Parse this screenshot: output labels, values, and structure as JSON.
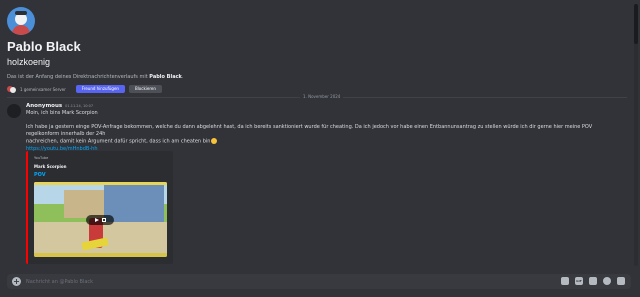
{
  "profile": {
    "display_name": "Pablo Black",
    "username": "holzkoenig",
    "intro_prefix": "Das ist der Anfang deines Direktnachrichtenverlaufs mit ",
    "intro_name": "Pablo Black",
    "intro_suffix": ".",
    "mutual_servers": "1 gemeinsamer Server",
    "add_friend_label": "Freund hinzufügen",
    "block_label": "Blockieren"
  },
  "divider": {
    "date": "1. November 2024"
  },
  "message": {
    "author": "Anonymous",
    "timestamp": "01.11.24, 10:07",
    "line1": "Moin, ich bins Mark Scorpion",
    "line2": "Ich habe ja gestern einge POV-Anfrage bekommen, welche du dann abgelehnt hast, da ich bereits sanktioniert wurde für cheating. Da ich jedoch vor habe einen Entbannunsantrag zu stellen würde ich dir gerne hier meine POV regelkonform innerhalb der 24h",
    "line3": "nachreichen, damit kein Argument dafür spricht, dass ich am cheaten bin",
    "link": "https://youtu.be/mHnbdB-hh"
  },
  "embed": {
    "provider": "YouTube",
    "author": "Mark Scorpion",
    "title": "POV",
    "accent_color": "#ff0000"
  },
  "composer": {
    "placeholder": "Nachricht an @Pablo Black",
    "tools": [
      "gift-icon",
      "gif-icon",
      "sticker-icon",
      "emoji-icon",
      "apps-icon"
    ],
    "gif_label": "GIF"
  },
  "colors": {
    "background": "#313338",
    "accent": "#5865f2",
    "link": "#00a8fc"
  }
}
